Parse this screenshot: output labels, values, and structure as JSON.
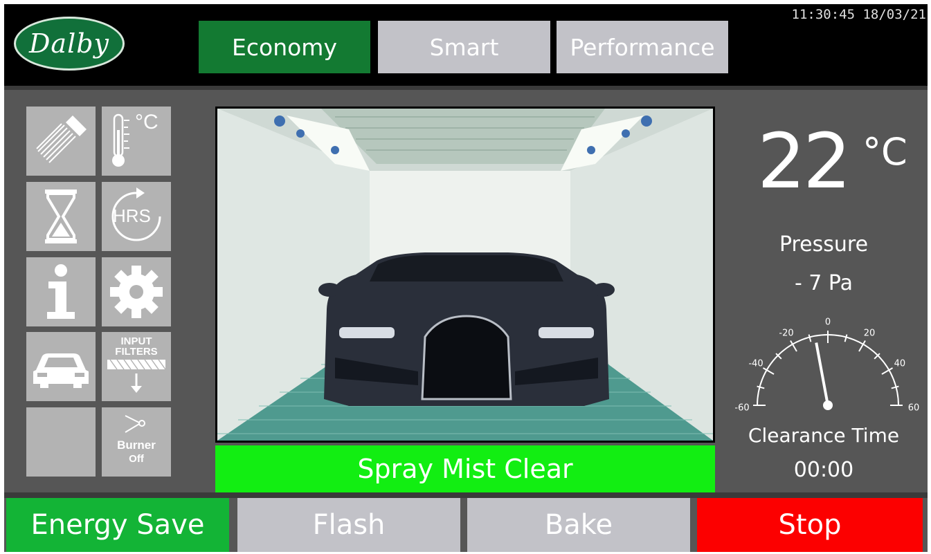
{
  "header": {
    "logo_text": "Dalby",
    "modes": [
      {
        "label": "Economy",
        "active": true
      },
      {
        "label": "Smart",
        "active": false
      },
      {
        "label": "Performance",
        "active": false
      }
    ],
    "time": "11:30:45",
    "date": "18/03/21"
  },
  "sidebar": {
    "tiles": [
      {
        "name": "spray-icon"
      },
      {
        "name": "thermometer-icon",
        "label": "°C"
      },
      {
        "name": "hourglass-icon"
      },
      {
        "name": "hours-counter-icon",
        "label": "HRS"
      },
      {
        "name": "info-icon"
      },
      {
        "name": "settings-gear-icon"
      },
      {
        "name": "car-icon"
      },
      {
        "name": "input-filters-icon",
        "label_line1": "INPUT",
        "label_line2": "FILTERS"
      },
      {
        "name": "empty-tile"
      },
      {
        "name": "burner-icon",
        "label_line1": "Burner",
        "label_line2": "Off"
      }
    ]
  },
  "main": {
    "status": "Spray Mist Clear",
    "status_color": "#12ee12"
  },
  "readings": {
    "temperature": "22",
    "temperature_unit": "°C",
    "pressure_label": "Pressure",
    "pressure_value": "- 7 Pa",
    "pressure_numeric": -7,
    "gauge_min": -60,
    "gauge_max": 60,
    "gauge_ticks": [
      "-60",
      "-40",
      "-20",
      "0",
      "20",
      "40",
      "60"
    ],
    "clearance_label": "Clearance Time",
    "clearance_value": "00:00"
  },
  "controls": {
    "energy_save": "Energy Save",
    "flash": "Flash",
    "bake": "Bake",
    "stop": "Stop"
  },
  "colors": {
    "active_green": "#137a32",
    "inactive_grey": "#c2c2c8",
    "stop_red": "#fc0000",
    "energy_green": "#13b436"
  }
}
